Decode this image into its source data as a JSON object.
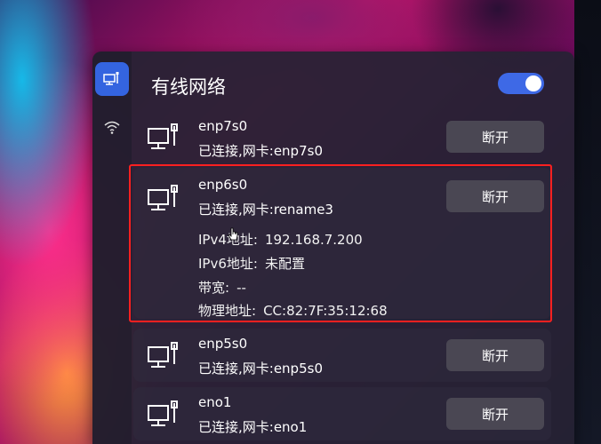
{
  "panel": {
    "title": "有线网络",
    "toggle_on": true
  },
  "nav": [
    {
      "icon": "wired-network-icon",
      "active": true
    },
    {
      "icon": "wifi-icon",
      "active": false
    }
  ],
  "connections": [
    {
      "name": "enp7s0",
      "status": "已连接,网卡:enp7s0",
      "button": "断开"
    },
    {
      "name": "enp6s0",
      "status": "已连接,网卡:rename3",
      "button": "断开",
      "details": [
        {
          "key": "IPv4地址:",
          "value": "192.168.7.200"
        },
        {
          "key": "IPv6地址:",
          "value": "未配置"
        },
        {
          "key": "带宽:",
          "value": "--"
        },
        {
          "key": "物理地址:",
          "value": "CC:82:7F:35:12:68"
        }
      ]
    },
    {
      "name": "enp5s0",
      "status": "已连接,网卡:enp5s0",
      "button": "断开"
    },
    {
      "name": "eno1",
      "status": "已连接,网卡:eno1",
      "button": "断开"
    }
  ],
  "colors": {
    "accent": "#3e69e6",
    "highlight": "#ff2020"
  }
}
